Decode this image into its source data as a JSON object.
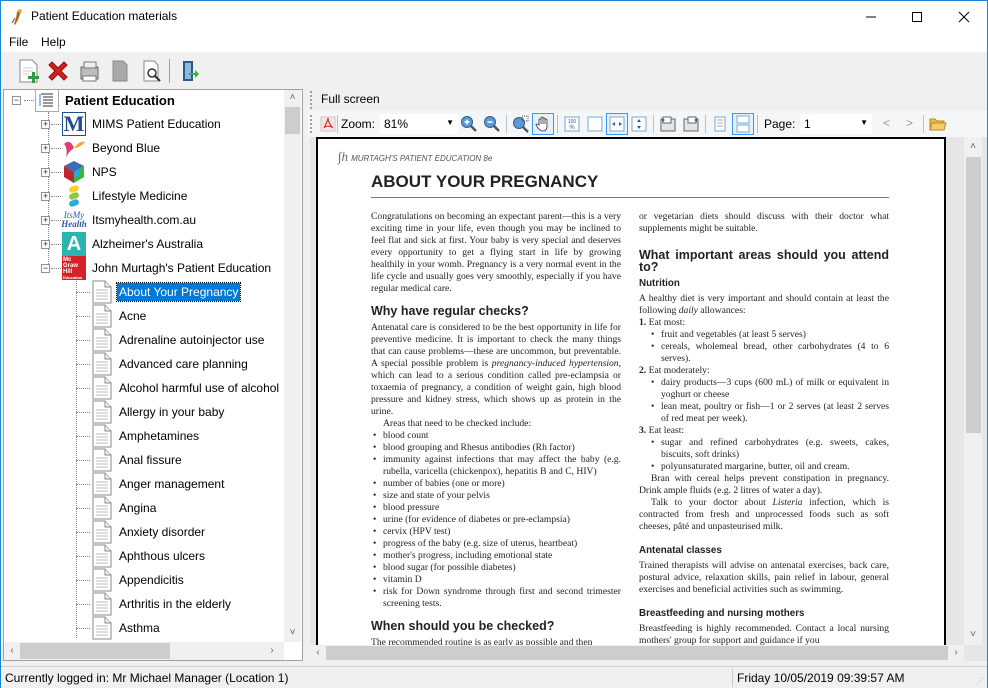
{
  "window": {
    "title": "Patient Education materials",
    "controls": {
      "minimize": "minimize",
      "maximize": "maximize",
      "close": "close"
    }
  },
  "menu": {
    "items": [
      {
        "label": "File"
      },
      {
        "label": "Help"
      }
    ]
  },
  "toolbar": {
    "buttons": [
      {
        "name": "new-document",
        "icon": "document-add-icon"
      },
      {
        "name": "delete",
        "icon": "red-x-icon"
      },
      {
        "name": "print",
        "icon": "printer-icon"
      },
      {
        "name": "blank-page",
        "icon": "page-icon"
      },
      {
        "name": "preview",
        "icon": "document-search-icon"
      },
      {
        "name": "exit",
        "icon": "exit-door-icon"
      }
    ]
  },
  "tree": {
    "root": {
      "label": "Patient Education",
      "expanded": true
    },
    "providers": [
      {
        "label": "MIMS Patient Education",
        "icon": "mims-logo",
        "expanded": false
      },
      {
        "label": "Beyond Blue",
        "icon": "beyond-blue-logo",
        "expanded": false
      },
      {
        "label": "NPS",
        "icon": "nps-logo",
        "expanded": false
      },
      {
        "label": "Lifestyle Medicine",
        "icon": "lifestyle-medicine-logo",
        "expanded": false
      },
      {
        "label": "Itsmyhealth.com.au",
        "icon": "itsmyhealth-logo",
        "expanded": false
      },
      {
        "label": "Alzheimer's Australia",
        "icon": "alzheimers-logo",
        "expanded": false
      },
      {
        "label": "John Murtagh's Patient Education",
        "icon": "mcgraw-hill-logo",
        "expanded": true
      }
    ],
    "documents": [
      {
        "label": "About Your Pregnancy",
        "selected": true
      },
      {
        "label": "Acne"
      },
      {
        "label": "Adrenaline autoinjector use"
      },
      {
        "label": "Advanced care planning"
      },
      {
        "label": "Alcohol harmful use of alcohol"
      },
      {
        "label": "Allergy in your baby"
      },
      {
        "label": "Amphetamines"
      },
      {
        "label": "Anal fissure"
      },
      {
        "label": "Anger management"
      },
      {
        "label": "Angina"
      },
      {
        "label": "Anxiety disorder"
      },
      {
        "label": "Aphthous ulcers"
      },
      {
        "label": "Appendicitis"
      },
      {
        "label": "Arthritis in the elderly"
      },
      {
        "label": "Asthma"
      }
    ]
  },
  "viewer": {
    "fullscreen_label": "Full screen",
    "zoom_label": "Zoom:",
    "zoom_value": "81%",
    "page_label": "Page:",
    "page_value": "1",
    "prev": "<",
    "next": ">"
  },
  "document": {
    "header": "MURTAGH'S PATIENT EDUCATION 8e",
    "title": "ABOUT YOUR PREGNANCY",
    "left": {
      "intro": "Congratulations on becoming an expectant parent—this is a very exciting time in your life, even though you may be inclined to feel flat and sick at first. Your baby is very special and deserves every opportunity to get a flying start in life by growing healthily in your womb. Pregnancy is a very normal event in the life cycle and usually goes very smoothly, especially if you have regular medical care.",
      "h_checks": "Why have regular checks?",
      "checks_p1a": "Antenatal care is considered to be the best opportunity in life for preventive medicine. It is important to check the many things that can cause problems—these are uncommon, but preventable. A special possible problem is ",
      "checks_p1_em": "pregnancy-induced hypertension",
      "checks_p1b": ", which can lead to a serious condition called pre-eclampsia or toxaemia of pregnancy, a condition of weight gain, high blood pressure and kidney stress, which shows up as protein in the urine.",
      "checks_p2": "Areas that need to be checked include:",
      "checks_list": [
        "blood count",
        "blood grouping and Rhesus antibodies (Rh factor)",
        "immunity against infections that may affect the baby (e.g. rubella, varicella (chickenpox), hepatitis B and C, HIV)",
        "number of babies (one or more)",
        "size and state of your pelvis",
        "blood pressure",
        "urine (for evidence of diabetes or pre-eclampsia)",
        "cervix (HPV test)",
        "progress of the baby (e.g. size of uterus, heartbeat)",
        "mother's progress, including emotional state",
        "blood sugar (for possible diabetes)",
        "vitamin D",
        "risk for Down syndrome through first and second trimester screening tests."
      ],
      "h_when": "When should you be checked?",
      "when_p": "The recommended routine is as early as possible and then"
    },
    "right": {
      "cont": "or vegetarian diets should discuss with their doctor what supplements might be suitable.",
      "h_areas": "What important areas should you attend to?",
      "h_nutrition": "Nutrition",
      "nutrition_a": "A healthy diet is very important and should contain at least the following ",
      "nutrition_em": "daily",
      "nutrition_b": " allowances:",
      "eat_most": "Eat most:",
      "eat_most_list": [
        "fruit and vegetables (at least 5 serves)",
        "cereals, wholemeal bread, other carbohydrates (4 to 6 serves)."
      ],
      "eat_mod": "Eat moderately:",
      "eat_mod_list": [
        "dairy products—3 cups (600 mL) of milk or equivalent in yoghurt or cheese",
        "lean meat, poultry or fish—1 or 2 serves (at least 2 serves of red meat per week)."
      ],
      "eat_least": "Eat least:",
      "eat_least_list": [
        "sugar and refined carbohydrates (e.g. sweets, cakes, biscuits, soft drinks)",
        "polyunsaturated margarine, butter, oil and cream."
      ],
      "bran": "Bran with cereal helps prevent constipation in pregnancy. Drink ample fluids (e.g. 2 litres of water a day).",
      "listeria_a": "Talk to your doctor about ",
      "listeria_em": "Listeria",
      "listeria_b": " infection, which is contracted from fresh and unprocessed foods such as soft cheeses, pâté and unpasteurised milk.",
      "h_antenatal": "Antenatal classes",
      "antenatal": "Trained therapists will advise on antenatal exercises, back care, postural advice, relaxation skills, pain relief in labour, general exercises and beneficial activities such as swimming.",
      "h_breast": "Breastfeeding and nursing mothers",
      "breast": "Breastfeeding is highly recommended. Contact a local nursing mothers' group for support and guidance if you"
    }
  },
  "status": {
    "logged_in": "Currently logged in:  Mr Michael Manager (Location 1)",
    "datetime": "Friday 10/05/2019 09:39:57 AM"
  }
}
